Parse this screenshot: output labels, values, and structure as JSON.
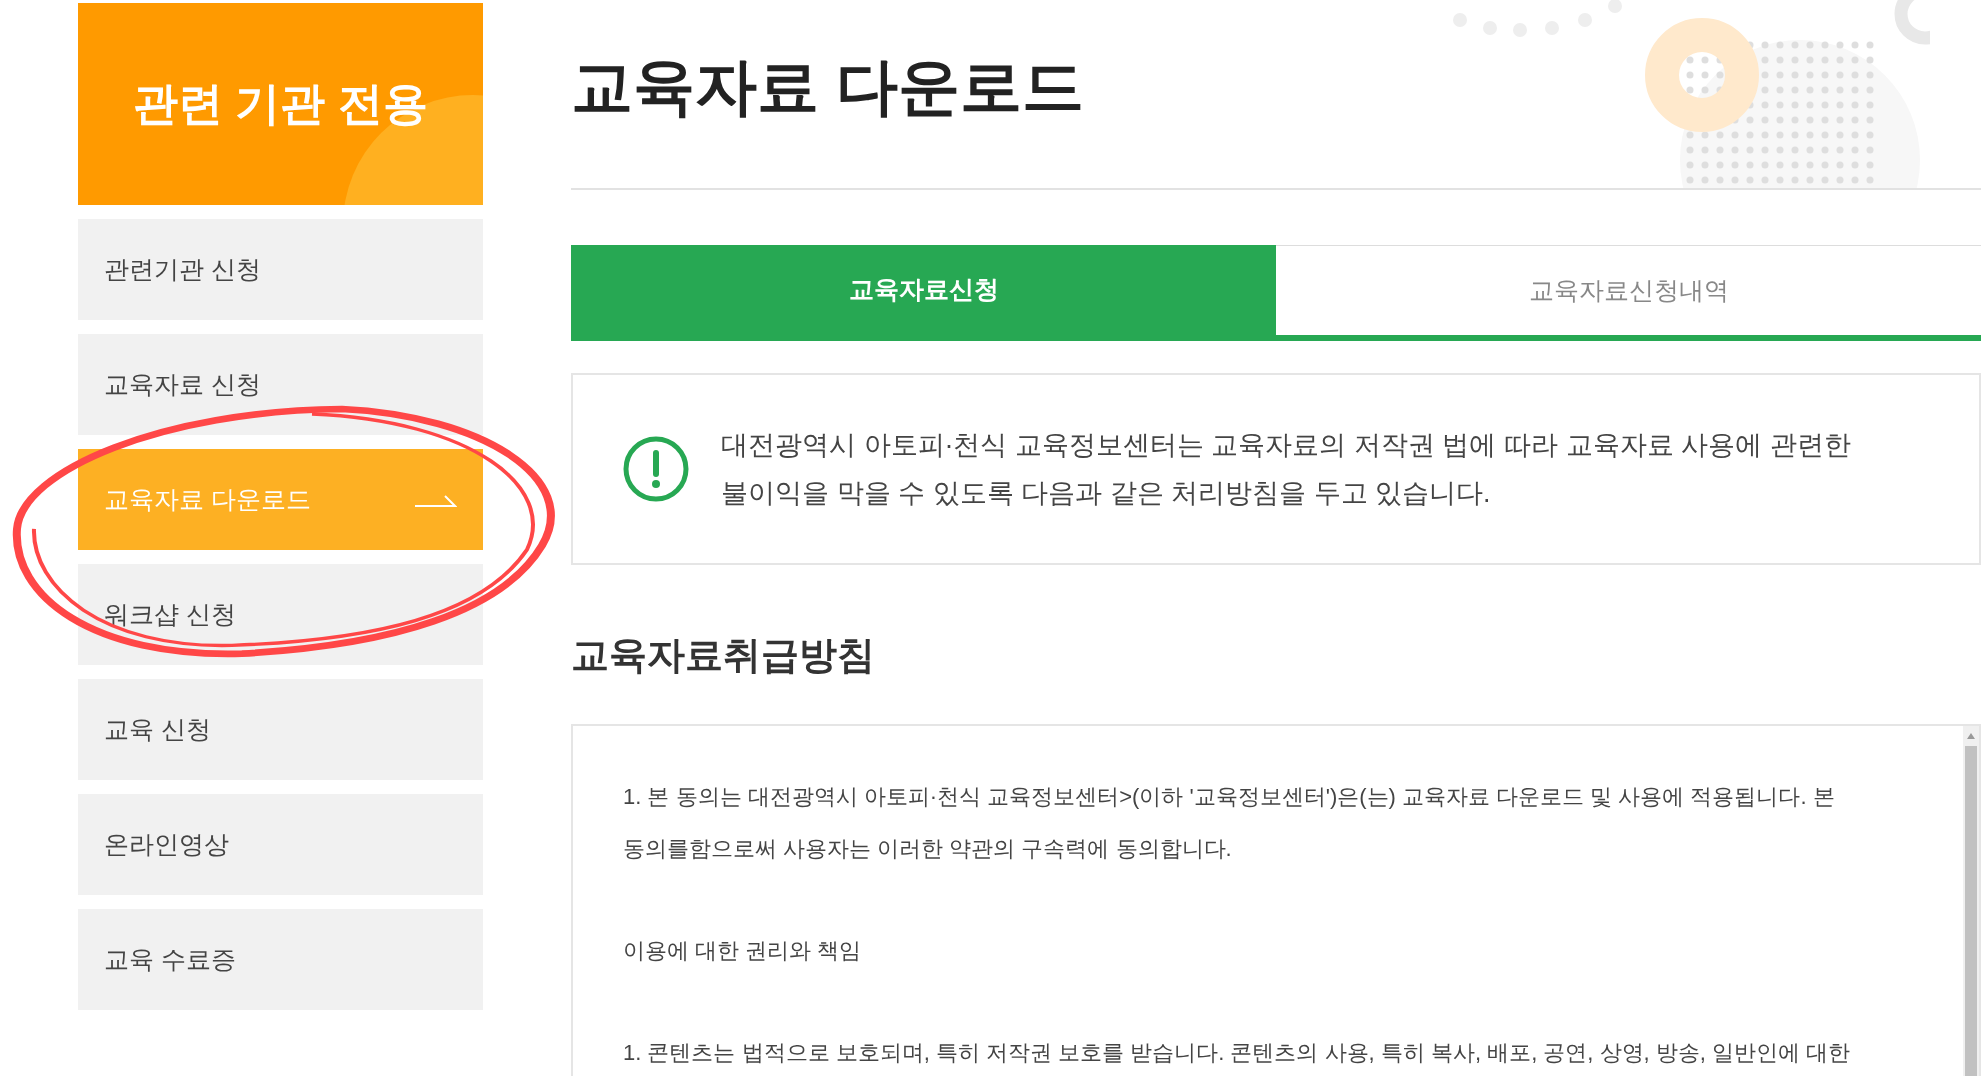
{
  "sidebar": {
    "title": "관련 기관 전용",
    "items": [
      {
        "label": "관련기관 신청",
        "selected": false
      },
      {
        "label": "교육자료 신청",
        "selected": false
      },
      {
        "label": "교육자료 다운로드",
        "selected": true
      },
      {
        "label": "워크샵 신청",
        "selected": false
      },
      {
        "label": "교육 신청",
        "selected": false
      },
      {
        "label": "온라인영상",
        "selected": false
      },
      {
        "label": "교육 수료증",
        "selected": false
      }
    ]
  },
  "page_title": "교육자료 다운로드",
  "tabs": [
    {
      "label": "교육자료신청",
      "selected": true
    },
    {
      "label": "교육자료신청내역",
      "selected": false
    }
  ],
  "notice": "대전광역시 아토피·천식 교육정보센터는 교육자료의 저작권 법에 따라 교육자료 사용에 관련한 불이익을 막을 수 있도록 다음과 같은 처리방침을 두고 있습니다.",
  "section_title": "교육자료취급방침",
  "terms": [
    "1. 본 동의는 대전광역시 아토피·천식 교육정보센터>(이하 '교육정보센터')은(는) 교육자료 다운로드 및 사용에 적용됩니다. 본 동의를함으로써 사용자는 이러한 약관의 구속력에 동의합니다.",
    "이용에 대한 권리와 책임",
    "1. 콘텐츠는 법적으로 보호되며, 특히 저작권 보호를 받습니다. 콘텐츠의 사용, 특히 복사, 배포, 공연, 상영, 방송, 일반인에 대한"
  ]
}
